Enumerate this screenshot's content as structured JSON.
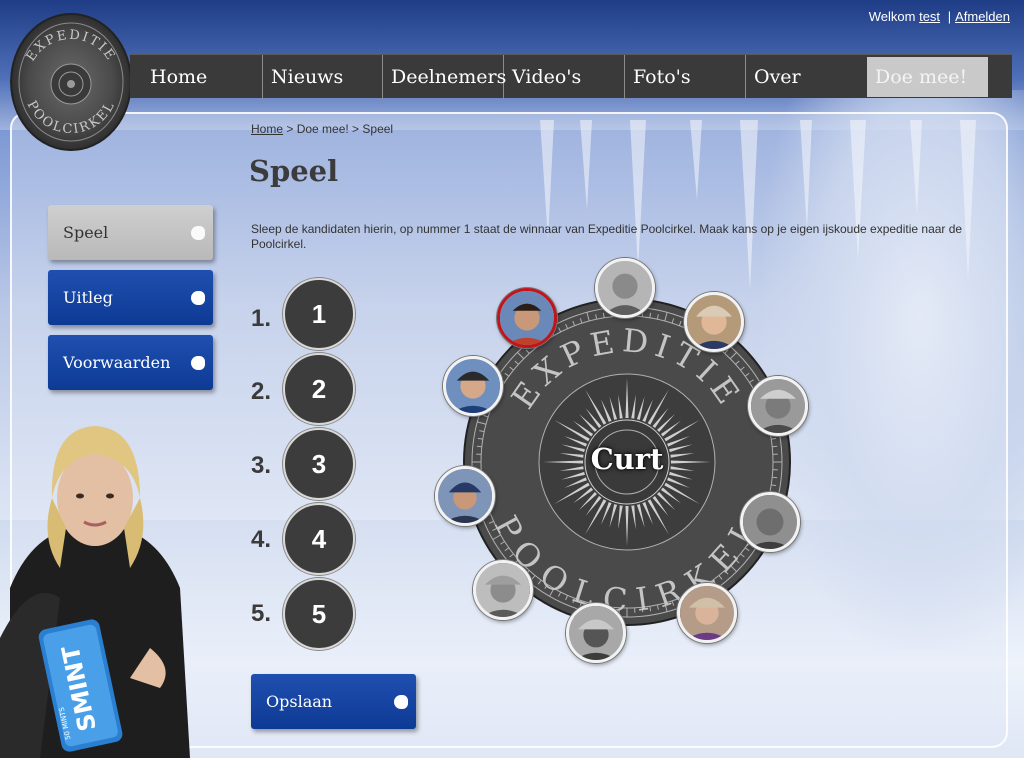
{
  "header": {
    "welcome_text": "Welkom",
    "username": "test",
    "separator": "|",
    "logout": "Afmelden"
  },
  "logo": {
    "line1": "EXPEDITIE",
    "line2": "POOLCIRKEL"
  },
  "nav": {
    "items": [
      {
        "label": "Home"
      },
      {
        "label": "Nieuws"
      },
      {
        "label": "Deelnemers"
      },
      {
        "label": "Video's"
      },
      {
        "label": "Foto's"
      },
      {
        "label": "Over"
      },
      {
        "label": "Doe mee!"
      }
    ],
    "active_index": 6
  },
  "breadcrumb": {
    "home": "Home",
    "rest": " > Doe mee! > Speel"
  },
  "page": {
    "title": "Speel",
    "intro": "Sleep de kandidaten hierin, op nummer 1 staat de winnaar van Expeditie Poolcirkel. Maak kans op je eigen ijskoude expeditie naar de Poolcirkel."
  },
  "side_menu": [
    {
      "label": "Speel",
      "active": true
    },
    {
      "label": "Uitleg",
      "active": false
    },
    {
      "label": "Voorwaarden",
      "active": false
    }
  ],
  "ranking": {
    "slots": [
      {
        "number": "1.",
        "label": "1"
      },
      {
        "number": "2.",
        "label": "2"
      },
      {
        "number": "3.",
        "label": "3"
      },
      {
        "number": "4.",
        "label": "4"
      },
      {
        "number": "5.",
        "label": "5"
      }
    ],
    "save_label": "Opslaan"
  },
  "compass": {
    "top_text": "EXPEDITIE",
    "bottom_text": "POOLCIRKEL",
    "selected_candidate": "Curt"
  },
  "promo": {
    "brand": "SMINT",
    "sub": "50 MINTS"
  },
  "colors": {
    "nav_bg": "#3a3a3a",
    "button_blue": "#0d3a94",
    "button_grey": "#c4c4c4",
    "slot_bg": "#3c3c3c",
    "selected_ring": "#c4141b"
  }
}
